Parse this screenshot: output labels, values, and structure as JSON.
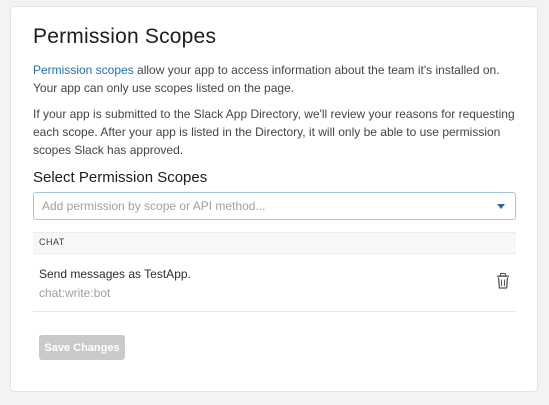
{
  "header": {
    "title": "Permission Scopes"
  },
  "intro": {
    "link_text": "Permission scopes",
    "text_after_link": " allow your app to access information about the team it's installed on. Your app can only use scopes listed on the page.",
    "review_text": "If your app is submitted to the Slack App Directory, we'll review your reasons for requesting each scope. After your app is listed in the Directory, it will only be able to use permission scopes Slack has approved."
  },
  "select_section": {
    "heading": "Select Permission Scopes",
    "placeholder": "Add permission by scope or API method..."
  },
  "scope_groups": [
    {
      "label": "CHAT",
      "scopes": [
        {
          "description": "Send messages as TestApp.",
          "name": "chat:write:bot"
        }
      ]
    }
  ],
  "actions": {
    "save_label": "Save Changes"
  },
  "colors": {
    "link": "#1f6fb5",
    "select_border": "#9cc7e8",
    "disabled_button": "#c9c9cc"
  },
  "icons": {
    "select_caret": "caret-down-icon",
    "remove_scope": "trash-icon"
  }
}
